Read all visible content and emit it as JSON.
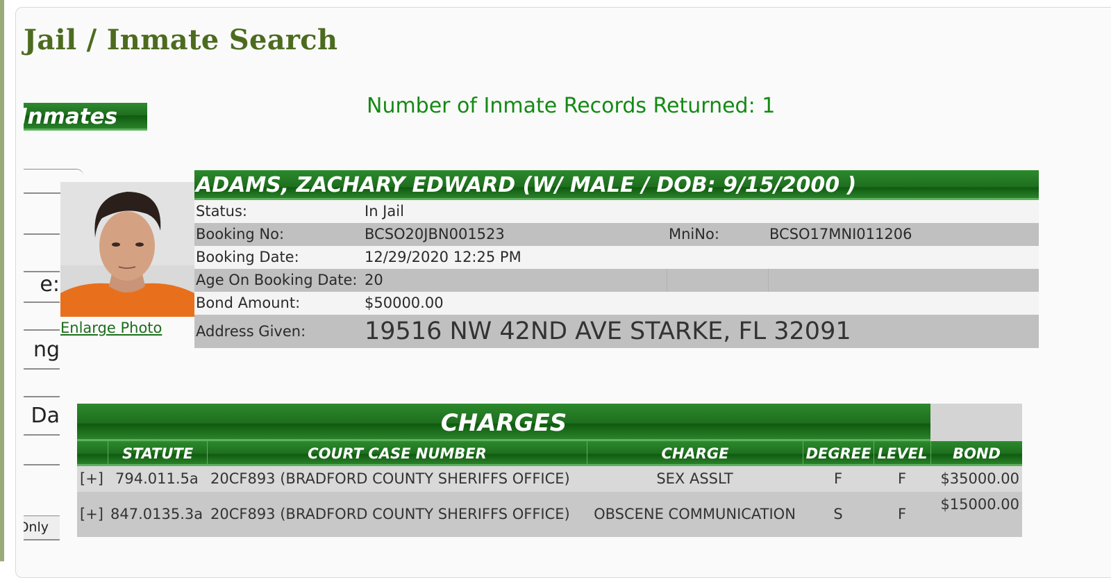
{
  "page": {
    "title": "Jail / Inmate Search",
    "inmates_tab_label": "Inmates",
    "records_returned": "Number of Inmate Records Returned: 1"
  },
  "sidebar": {
    "fields": [
      {
        "text": ""
      },
      {
        "text": ""
      },
      {
        "text": "e:"
      },
      {
        "text": "ng"
      },
      {
        "text": ""
      },
      {
        "text": "g Da"
      },
      {
        "text": ""
      }
    ],
    "only_button_label": "Only"
  },
  "inmate": {
    "header": "ADAMS, ZACHARY EDWARD   (W/ MALE / DOB: 9/15/2000 )",
    "enlarge_photo_label": "Enlarge Photo",
    "rows": {
      "status": {
        "label": "Status:",
        "value": "In Jail"
      },
      "booking_no": {
        "label": "Booking No:",
        "value": "BCSO20JBN001523",
        "label2": "MniNo:",
        "value2": "BCSO17MNI011206"
      },
      "booking_date": {
        "label": "Booking Date:",
        "value": "12/29/2020 12:25 PM"
      },
      "age": {
        "label": "Age On Booking Date:",
        "value": "20"
      },
      "bond": {
        "label": "Bond Amount:",
        "value": "$50000.00"
      },
      "address": {
        "label": "Address Given:",
        "value": "19516 NW 42ND AVE STARKE, FL 32091"
      }
    }
  },
  "charges": {
    "title": "CHARGES",
    "columns": {
      "statute": "STATUTE",
      "case": "COURT CASE NUMBER",
      "charge": "CHARGE",
      "degree": "DEGREE",
      "level": "LEVEL",
      "bond": "BOND"
    },
    "rows": [
      {
        "expand": "[+]",
        "statute": "794.011.5a",
        "case": "20CF893 (BRADFORD COUNTY SHERIFFS OFFICE)",
        "charge": "SEX ASSLT",
        "degree": "F",
        "level": "F",
        "bond": "$35000.00"
      },
      {
        "expand": "[+]",
        "statute": "847.0135.3a",
        "case": "20CF893 (BRADFORD COUNTY SHERIFFS OFFICE)",
        "charge": "OBSCENE COMMUNICATION",
        "degree": "S",
        "level": "F",
        "bond": "$15000.00"
      }
    ]
  },
  "colors": {
    "header_green": "#1e6e1e",
    "title_olive": "#4d6b1f",
    "records_green": "#148a14",
    "row_gray": "#c0c0c0"
  }
}
